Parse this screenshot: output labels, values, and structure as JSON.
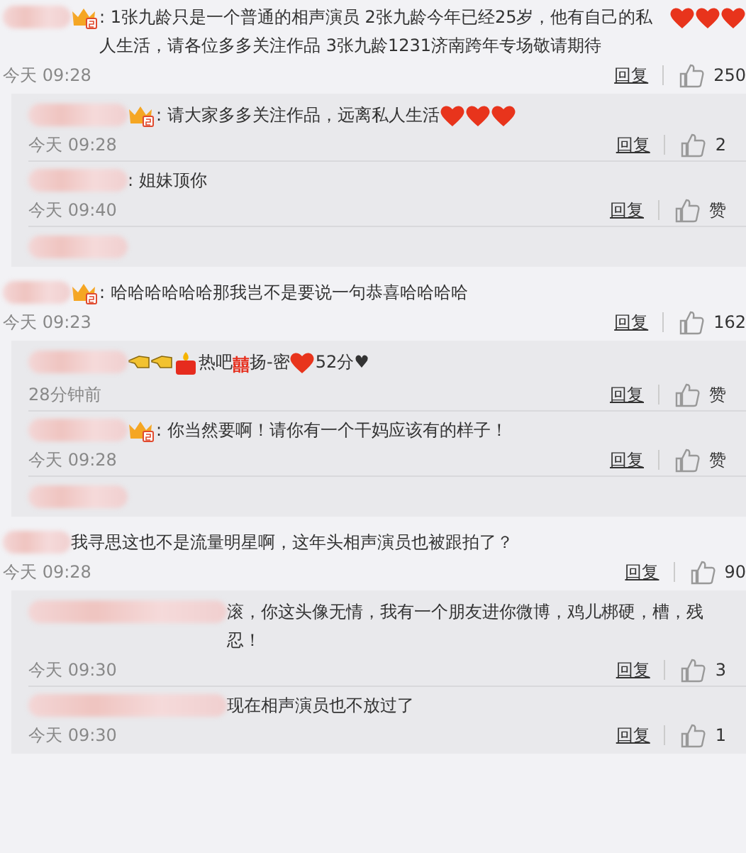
{
  "comments": [
    {
      "badge": true,
      "segments": [
        {
          "kind": "text",
          "text": ": 1张九龄只是一个普通的相声演员  2张九龄今年已经25岁，他有自己的私人生活，请各位多多关注作品  3张九龄1231济南跨年专场敬请期待"
        },
        {
          "kind": "heart"
        },
        {
          "kind": "heart"
        },
        {
          "kind": "heart"
        }
      ],
      "time": "今天 09:28",
      "reply": "回复",
      "likes": "250",
      "replies": [
        {
          "kind": "comment",
          "badge": true,
          "segments": [
            {
              "kind": "text",
              "text": ": 请大家多多关注作品，远离私人生活"
            },
            {
              "kind": "heart"
            },
            {
              "kind": "heart"
            },
            {
              "kind": "heart"
            }
          ],
          "time": "今天 09:28",
          "reply": "回复",
          "likes": "2"
        },
        {
          "kind": "comment",
          "badge": false,
          "segments": [
            {
              "kind": "text",
              "text": ": 姐妹顶你"
            }
          ],
          "time": "今天 09:40",
          "reply": "回复",
          "likes": "赞"
        },
        {
          "kind": "stub"
        }
      ]
    },
    {
      "badge": true,
      "segments": [
        {
          "kind": "text",
          "text": ": 哈哈哈哈哈哈那我岂不是要说一句恭喜哈哈哈哈"
        }
      ],
      "time": "今天 09:23",
      "reply": "回复",
      "likes": "162",
      "replies": [
        {
          "kind": "comment",
          "badge": false,
          "segments": [
            {
              "kind": "hand"
            },
            {
              "kind": "hand"
            },
            {
              "kind": "candle"
            },
            {
              "kind": "text",
              "text": "热吧"
            },
            {
              "kind": "xi",
              "text": "囍"
            },
            {
              "kind": "text",
              "text": "扬-密"
            },
            {
              "kind": "heart"
            },
            {
              "kind": "text",
              "text": "52分♥"
            }
          ],
          "time": "28分钟前",
          "reply": "回复",
          "likes": "赞"
        },
        {
          "kind": "comment",
          "badge": true,
          "segments": [
            {
              "kind": "text",
              "text": ": 你当然要啊！请你有一个干妈应该有的样子！"
            }
          ],
          "time": "今天 09:28",
          "reply": "回复",
          "likes": "赞"
        },
        {
          "kind": "stub"
        }
      ]
    },
    {
      "badge": false,
      "segments": [
        {
          "kind": "text",
          "text": "我寻思这也不是流量明星啊，这年头相声演员也被跟拍了？"
        }
      ],
      "time": "今天 09:28",
      "reply": "回复",
      "likes": "90",
      "replies": [
        {
          "kind": "comment",
          "badge": false,
          "segments": [
            {
              "kind": "text",
              "text": "滚，你这头像无情，我有一个朋友进你微博，鸡儿梆硬，槽，残忍！"
            }
          ],
          "time": "今天 09:30",
          "reply": "回复",
          "likes": "3"
        },
        {
          "kind": "comment",
          "badge": false,
          "segments": [
            {
              "kind": "text",
              "text": "现在相声演员也不放过了"
            }
          ],
          "time": "今天 09:30",
          "reply": "回复",
          "likes": "1"
        }
      ]
    }
  ]
}
